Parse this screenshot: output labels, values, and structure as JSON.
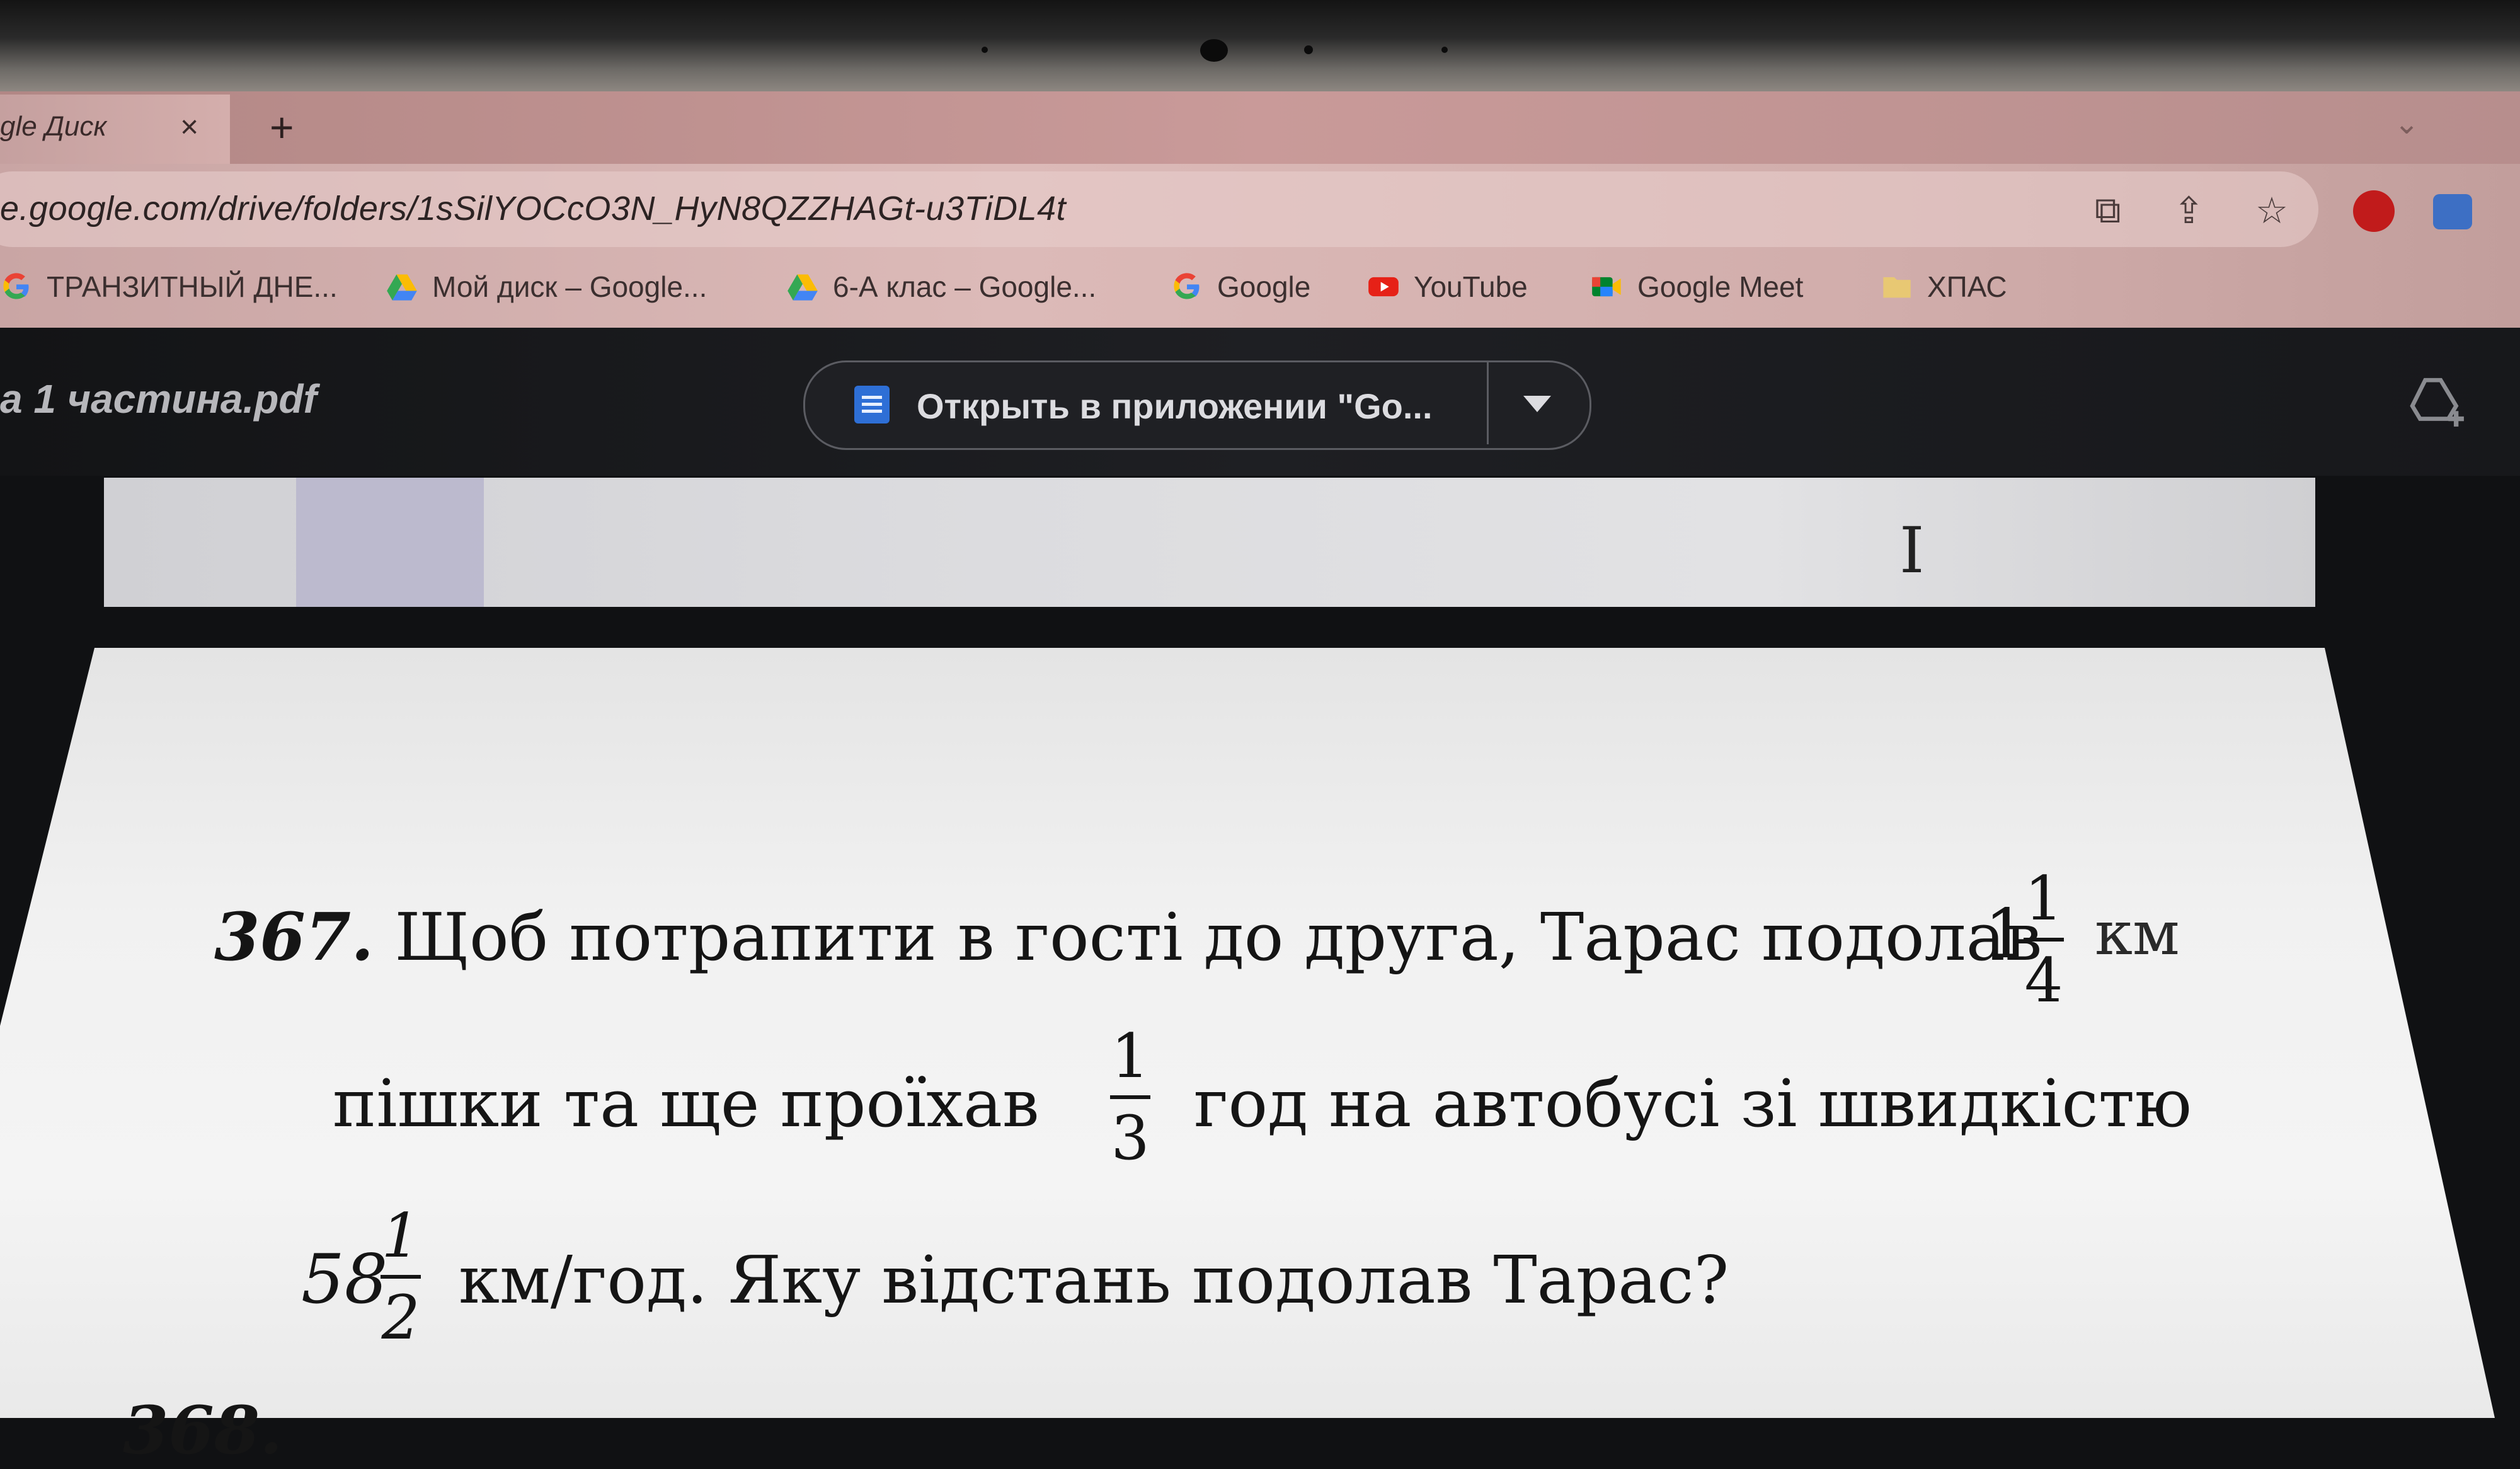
{
  "browser": {
    "tab": {
      "title": "gle Диск",
      "close": "×"
    },
    "new_tab": "+",
    "tab_menu": "⌄",
    "url": "e.google.com/drive/folders/1sSilYOCcO3N_HyN8QZZHAGt-u3TiDL4t",
    "toolbar_icons": {
      "open": "⧉",
      "share": "⇪",
      "star": "☆"
    },
    "bookmarks": [
      {
        "label": "ТРАНЗИТНЫЙ ДНЕ...",
        "icon": "google-g-icon"
      },
      {
        "label": "Мой диск – Google...",
        "icon": "google-drive-icon"
      },
      {
        "label": "6-А клас – Google...",
        "icon": "google-drive-icon"
      },
      {
        "label": "Google",
        "icon": "google-g-icon"
      },
      {
        "label": "YouTube",
        "icon": "youtube-icon"
      },
      {
        "label": "Google Meet",
        "icon": "google-meet-icon"
      },
      {
        "label": "ХПАС",
        "icon": "folder-icon"
      }
    ]
  },
  "viewer": {
    "file_name": "а 1 частина.pdf",
    "open_with": "Открыть в приложении \"Go...",
    "add_shortcut_icon": "add-to-drive-icon",
    "cursor": "I"
  },
  "problem": {
    "number": "367.",
    "line1": "Щоб потрапити в гості до друга, Тарас подолав",
    "frac1": {
      "whole": "1",
      "num": "1",
      "den": "4"
    },
    "unit1": "км",
    "line2_a": "пішки та ще проїхав",
    "frac2": {
      "num": "1",
      "den": "3"
    },
    "line2_b": "год на автобусі зі швидкістю",
    "frac3": {
      "whole": "58",
      "num": "1",
      "den": "2"
    },
    "line3": "км/год. Яку відстань подолав Тарас?",
    "next_number": "368."
  },
  "colors": {
    "tab_strip": "#c99a99",
    "viewer_bg": "#1e1f23",
    "docs_blue": "#2e6fd6",
    "youtube_red": "#e62117"
  }
}
